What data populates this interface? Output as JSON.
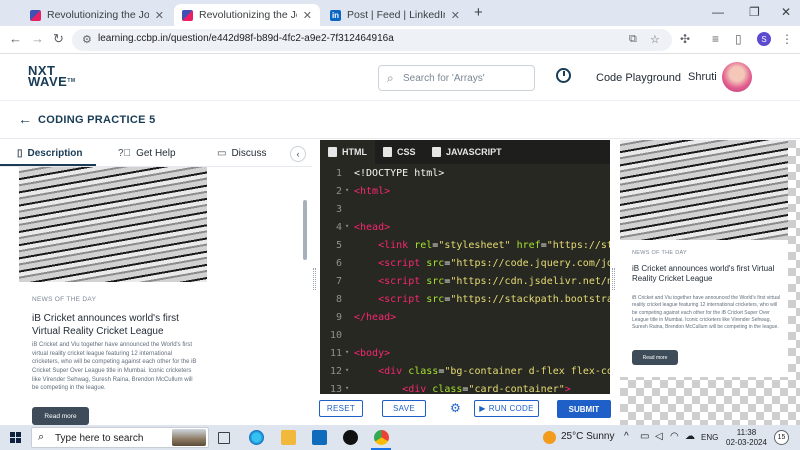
{
  "browser": {
    "tabs": [
      {
        "title": "Revolutionizing the Job Market",
        "active": false
      },
      {
        "title": "Revolutionizing the Job Market",
        "active": true
      },
      {
        "title": "Post | Feed | LinkedIn",
        "active": false
      }
    ],
    "url": "learning.ccbp.in/question/e442d98f-b89d-4fc2-a9e2-7f312464916a",
    "profile_initial": "S"
  },
  "header": {
    "logo_line1": "NXT",
    "logo_line2": "WAVE",
    "logo_tm": "TM",
    "search_placeholder": "Search for 'Arrays'",
    "code_playground": "Code Playground",
    "user_name": "Shruti"
  },
  "subheader": {
    "title": "CODING PRACTICE 5"
  },
  "left_panel": {
    "tabs": [
      {
        "label": "Description",
        "active": true
      },
      {
        "label": "Get Help",
        "active": false
      },
      {
        "label": "Discuss",
        "active": false
      }
    ]
  },
  "card": {
    "tag": "NEWS OF THE DAY",
    "headline": "iB Cricket announces world's first Virtual Reality Cricket League",
    "desc": "iB Cricket and Viu together have announced the World's first virtual reality cricket league featuring 12 international cricketers, who will be competing against each other for the iB Cricket Super Over League title in Mumbai. Iconic cricketers like Virender Sehwag, Suresh Raina, Brendon McCullum will be competing in the league.",
    "button": "Read more"
  },
  "editor": {
    "tabs": [
      {
        "label": "HTML",
        "active": true
      },
      {
        "label": "CSS",
        "active": false
      },
      {
        "label": "JAVASCRIPT",
        "active": false
      }
    ],
    "lines": [
      {
        "n": "1",
        "fold": false,
        "indent": "",
        "parts": [
          {
            "t": "<!DOCTYPE html>",
            "c": ""
          }
        ]
      },
      {
        "n": "2",
        "fold": true,
        "indent": "",
        "parts": [
          {
            "t": "<html>",
            "c": "tag"
          }
        ]
      },
      {
        "n": "3",
        "fold": false,
        "indent": "",
        "parts": []
      },
      {
        "n": "4",
        "fold": true,
        "indent": "",
        "parts": [
          {
            "t": "<head>",
            "c": "tag"
          }
        ]
      },
      {
        "n": "5",
        "fold": false,
        "indent": "    ",
        "parts": [
          {
            "t": "<link ",
            "c": "tag"
          },
          {
            "t": "rel",
            "c": "attr"
          },
          {
            "t": "=",
            "c": ""
          },
          {
            "t": "\"stylesheet\"",
            "c": "str"
          },
          {
            "t": " ",
            "c": ""
          },
          {
            "t": "href",
            "c": "attr"
          },
          {
            "t": "=",
            "c": ""
          },
          {
            "t": "\"https://stac",
            "c": "str"
          }
        ]
      },
      {
        "n": "6",
        "fold": false,
        "indent": "    ",
        "parts": [
          {
            "t": "<script ",
            "c": "tag"
          },
          {
            "t": "src",
            "c": "attr"
          },
          {
            "t": "=",
            "c": ""
          },
          {
            "t": "\"https://code.jquery.com/jque",
            "c": "str"
          }
        ]
      },
      {
        "n": "7",
        "fold": false,
        "indent": "    ",
        "parts": [
          {
            "t": "<script ",
            "c": "tag"
          },
          {
            "t": "src",
            "c": "attr"
          },
          {
            "t": "=",
            "c": ""
          },
          {
            "t": "\"https://cdn.jsdelivr.net/npm",
            "c": "str"
          }
        ]
      },
      {
        "n": "8",
        "fold": false,
        "indent": "    ",
        "parts": [
          {
            "t": "<script ",
            "c": "tag"
          },
          {
            "t": "src",
            "c": "attr"
          },
          {
            "t": "=",
            "c": ""
          },
          {
            "t": "\"https://stackpath.bootstrapc",
            "c": "str"
          }
        ]
      },
      {
        "n": "9",
        "fold": false,
        "indent": "",
        "parts": [
          {
            "t": "</head>",
            "c": "tag"
          }
        ]
      },
      {
        "n": "10",
        "fold": false,
        "indent": "",
        "parts": []
      },
      {
        "n": "11",
        "fold": true,
        "indent": "",
        "parts": [
          {
            "t": "<body>",
            "c": "tag"
          }
        ]
      },
      {
        "n": "12",
        "fold": true,
        "indent": "    ",
        "parts": [
          {
            "t": "<div ",
            "c": "tag"
          },
          {
            "t": "class",
            "c": "attr"
          },
          {
            "t": "=",
            "c": ""
          },
          {
            "t": "\"bg-container d-flex flex-colu",
            "c": "str"
          }
        ]
      },
      {
        "n": "13",
        "fold": true,
        "indent": "        ",
        "parts": [
          {
            "t": "<div ",
            "c": "tag"
          },
          {
            "t": "class",
            "c": "attr"
          },
          {
            "t": "=",
            "c": ""
          },
          {
            "t": "\"card-container\"",
            "c": "str"
          },
          {
            "t": ">",
            "c": "tag"
          }
        ]
      }
    ],
    "buttons": {
      "reset": "RESET",
      "save": "SAVE",
      "run": "RUN CODE",
      "submit": "SUBMIT"
    }
  },
  "taskbar": {
    "search_text": "Type here to search",
    "weather": "25°C Sunny",
    "lang": "ENG",
    "time": "11:38",
    "date": "02-03-2024",
    "notifications": "15"
  },
  "colors": {
    "brand": "#183b56",
    "accent": "#1f5fc8",
    "editor_bg": "#272822"
  }
}
